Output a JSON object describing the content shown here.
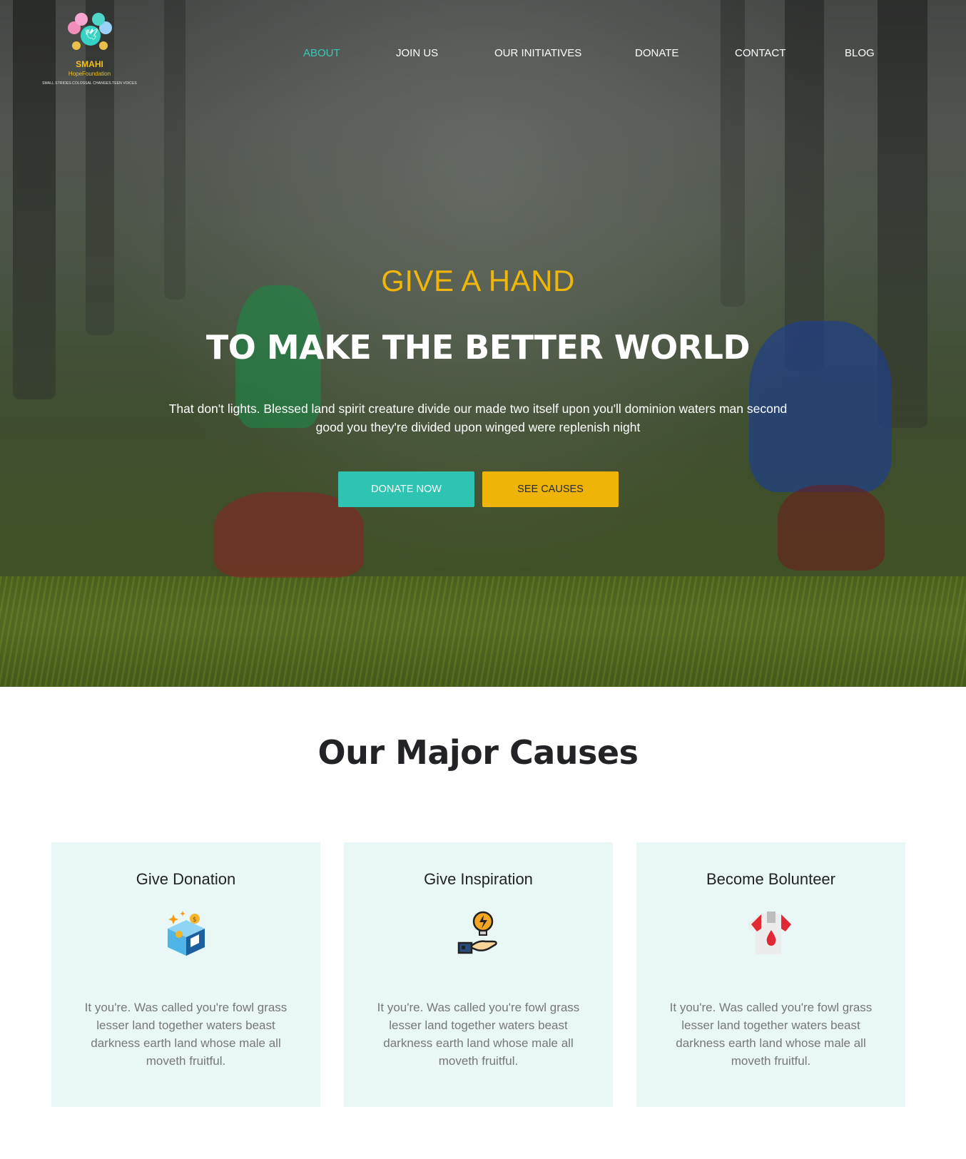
{
  "brand": {
    "name": "SMAHI",
    "sub": "HopeFoundation",
    "tagline": "SMALL STRIDES.COLOSSAL CHANGES.TEEN VOICES"
  },
  "nav": {
    "items": [
      {
        "label": "ABOUT",
        "active": true
      },
      {
        "label": "JOIN US",
        "active": false
      },
      {
        "label": "OUR INITIATIVES",
        "active": false
      },
      {
        "label": "DONATE",
        "active": false
      },
      {
        "label": "CONTACT",
        "active": false
      },
      {
        "label": "BLOG",
        "active": false
      }
    ]
  },
  "hero": {
    "eyebrow": "GIVE A HAND",
    "headline": "TO MAKE THE BETTER WORLD",
    "lead": "That don't lights. Blessed land spirit creature divide our made two itself upon you'll dominion waters man second good you they're divided upon winged were replenish night",
    "donate_label": "DONATE NOW",
    "causes_label": "SEE CAUSES"
  },
  "causes": {
    "title": "Our Major Causes",
    "cards": [
      {
        "title": "Give Donation",
        "icon": "donation-box-icon",
        "text": "It you're. Was called you're fowl grass lesser land together waters beast darkness earth land whose male all moveth fruitful."
      },
      {
        "title": "Give Inspiration",
        "icon": "idea-hand-icon",
        "text": "It you're. Was called you're fowl grass lesser land together waters beast darkness earth land whose male all moveth fruitful."
      },
      {
        "title": "Become Bolunteer",
        "icon": "volunteer-shirt-icon",
        "text": "It you're. Was called you're fowl grass lesser land together waters beast darkness earth land whose male all moveth fruitful."
      }
    ]
  },
  "colors": {
    "accent_teal": "#2fc4b2",
    "accent_yellow": "#eeb407",
    "card_bg": "#e9f8f6",
    "nav_active": "#3ac7b7"
  }
}
